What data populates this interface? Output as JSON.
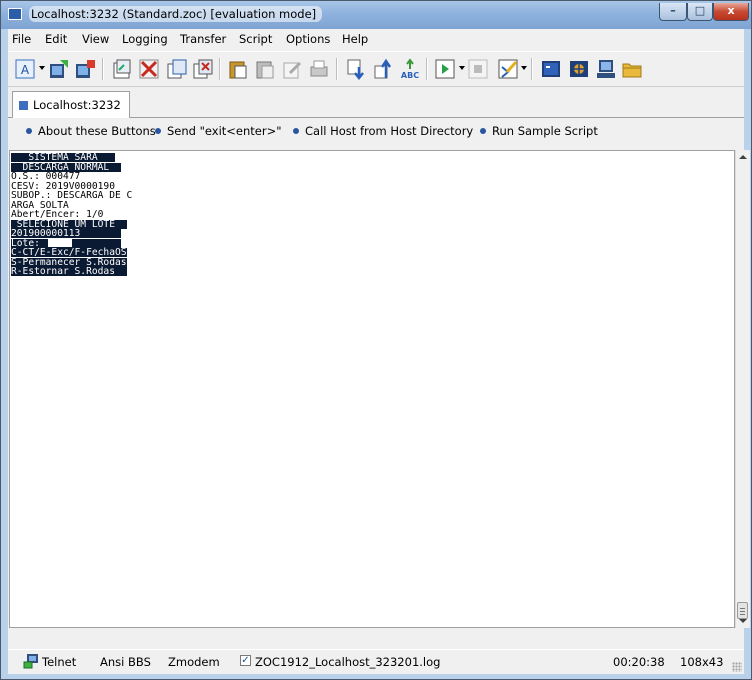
{
  "window": {
    "title": "Localhost:3232 (Standard.zoc) [evaluation mode]",
    "controls": {
      "minimize": "–",
      "maximize": "□",
      "close": "x"
    }
  },
  "menu": [
    "File",
    "Edit",
    "View",
    "Logging",
    "Transfer",
    "Script",
    "Options",
    "Help"
  ],
  "toolbar": {
    "icons": [
      "text-icon",
      "quick-connect-icon",
      "disconnect-icon",
      "new-session-icon",
      "close-session-icon",
      "copy-window-icon",
      "close-window-icon",
      "paste-icon",
      "paste-special-icon",
      "edit-icon",
      "print-icon",
      "download-icon",
      "upload-icon",
      "spell-check-icon",
      "play-script-icon",
      "stop-script-icon",
      "edit-script-icon",
      "terminal-icon",
      "capture-icon",
      "host-directory-icon",
      "folder-icon"
    ]
  },
  "tabs": [
    {
      "label": "Localhost:3232"
    }
  ],
  "user_buttons": [
    {
      "label": "About these Buttons"
    },
    {
      "label": "Send \"exit<enter>\""
    },
    {
      "label": "Call Host from Host Directory"
    },
    {
      "label": "Run Sample Script"
    }
  ],
  "terminal": {
    "lines": [
      {
        "text": "   SISTEMA SARA   ",
        "inverse": true
      },
      {
        "text": "  DESCARGA NORMAL  ",
        "inverse": true
      },
      {
        "text": "O.S.: 000477",
        "inverse": false
      },
      {
        "text": "CESV: 2019V0000190",
        "inverse": false
      },
      {
        "text": "SUBOP.: DESCARGA DE C",
        "inverse": false
      },
      {
        "text": "ARGA SOLTA",
        "inverse": false
      },
      {
        "text": "Abert/Encer: 1/0",
        "inverse": false
      },
      {
        "text": " SELECIONE UM LOTE  ",
        "inverse": true
      },
      {
        "text": "201900000113       ",
        "inverse": true
      },
      {
        "text": "Lote:              ",
        "inverse": true
      },
      {
        "text": "C-CT/E-Exc/F-FechaOS",
        "inverse": true
      },
      {
        "text": "S-Permanecer S.Rodas",
        "inverse": true
      },
      {
        "text": "R-Estornar S.Rodas  ",
        "inverse": true
      }
    ]
  },
  "status": {
    "protocol": "Telnet",
    "emulation": "Ansi BBS",
    "transfer": "Zmodem",
    "log_checked": true,
    "logfile": "ZOC1912_Localhost_323201.log",
    "time": "00:20:38",
    "size": "108x43"
  },
  "colors": {
    "terminal_inverse_bg": "#0b1a33",
    "button_dot": "#2a55a0",
    "chrome": "#f0f0f0"
  }
}
